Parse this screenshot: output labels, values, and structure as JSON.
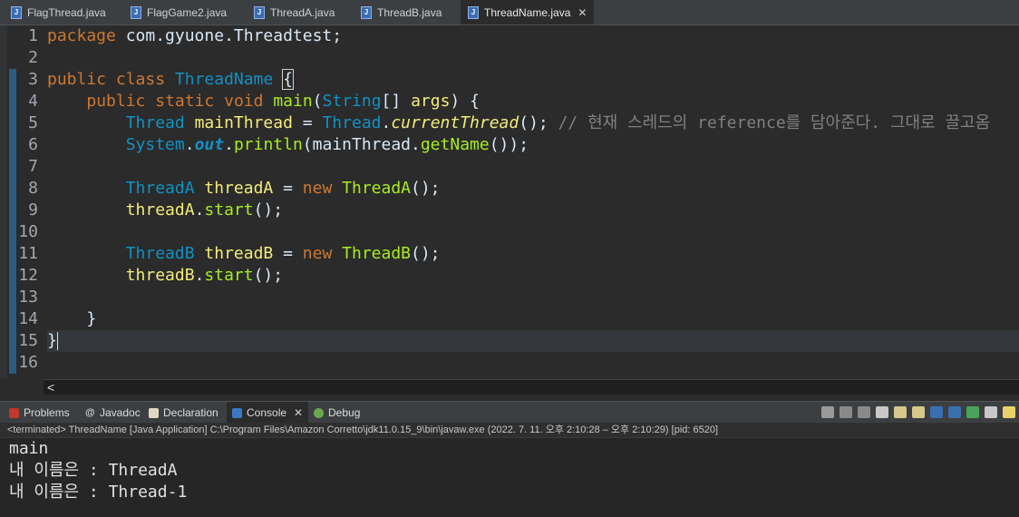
{
  "editor_tabs": [
    {
      "label": "FlagThread.java"
    },
    {
      "label": "FlagGame2.java"
    },
    {
      "label": "ThreadA.java"
    },
    {
      "label": "ThreadB.java"
    },
    {
      "label": "ThreadName.java",
      "active": true
    }
  ],
  "code": {
    "line_numbers": [
      "1",
      "2",
      "3",
      "4",
      "5",
      "6",
      "7",
      "8",
      "9",
      "10",
      "11",
      "12",
      "13",
      "14",
      "15",
      "16"
    ],
    "l1": {
      "kw": "package",
      "rest": " com.gyuone.Threadtest;"
    },
    "l3": {
      "kw1": "public",
      "kw2": "class",
      "name": "ThreadName",
      "brace": "{"
    },
    "l4": {
      "kw1": "public",
      "kw2": "static",
      "kw3": "void",
      "fn": "main",
      "p1": "(",
      "type": "String",
      "p2": "[] ",
      "arg": "args",
      "p3": ") {"
    },
    "l5": {
      "type": "Thread",
      "var": "mainThread",
      "eq": " = ",
      "type2": "Thread",
      "dot": ".",
      "fn": "currentThread",
      "p": "();",
      "comment": " // 현재 스레드의 reference를 담아준다. 그대로 끌고옴"
    },
    "l6": {
      "type": "System",
      "dot": ".",
      "field": "out",
      "rest1": ".",
      "fn": "println",
      "rest2": "(mainThread.",
      "fn2": "getName",
      "rest3": "());"
    },
    "l8": {
      "type": "ThreadA",
      "var": "threadA",
      "eq": " = ",
      "kw": "new",
      "ctor": "ThreadA",
      "p": "();"
    },
    "l9": {
      "var": "threadA",
      "dot": ".",
      "fn": "start",
      "p": "();"
    },
    "l11": {
      "type": "ThreadB",
      "var": "threadB",
      "eq": " = ",
      "kw": "new",
      "ctor": "ThreadB",
      "p": "();"
    },
    "l12": {
      "var": "threadB",
      "dot": ".",
      "fn": "start",
      "p": "();"
    },
    "l14": {
      "text": "}"
    },
    "l15": {
      "text": "}"
    }
  },
  "hscroll_arrow": "<",
  "view_tabs": [
    {
      "label": "Problems",
      "icon": "problems-icon"
    },
    {
      "label": "Javadoc",
      "icon": "javadoc-icon"
    },
    {
      "label": "Declaration",
      "icon": "declaration-icon"
    },
    {
      "label": "Console",
      "icon": "console-icon",
      "active": true
    },
    {
      "label": "Debug",
      "icon": "debug-icon"
    }
  ],
  "console_status": "<terminated> ThreadName [Java Application] C:\\Program Files\\Amazon Corretto\\jdk11.0.15_9\\bin\\javaw.exe  (2022. 7. 11. 오후 2:10:28 – 오후 2:10:29) [pid: 6520]",
  "console_output": [
    "main",
    "내 이름은 : ThreadA",
    "내 이름은 : Thread-1"
  ],
  "colors": {
    "keyword": "#cc7832",
    "type": "#1290c3",
    "method": "#a7ec21",
    "variable": "#f3ec79",
    "comment": "#808080"
  }
}
